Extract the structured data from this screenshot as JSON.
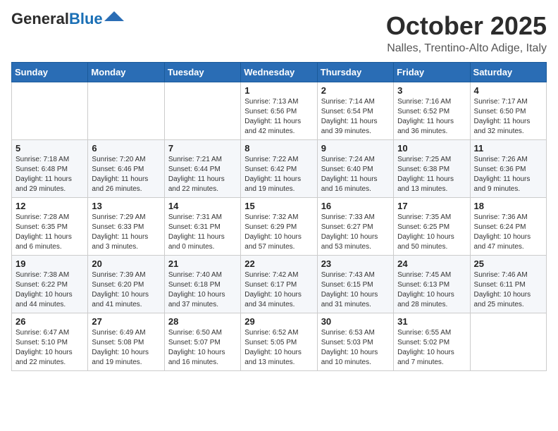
{
  "header": {
    "logo_general": "General",
    "logo_blue": "Blue",
    "month_title": "October 2025",
    "location": "Nalles, Trentino-Alto Adige, Italy"
  },
  "weekdays": [
    "Sunday",
    "Monday",
    "Tuesday",
    "Wednesday",
    "Thursday",
    "Friday",
    "Saturday"
  ],
  "weeks": [
    [
      {
        "day": "",
        "sunrise": "",
        "sunset": "",
        "daylight": ""
      },
      {
        "day": "",
        "sunrise": "",
        "sunset": "",
        "daylight": ""
      },
      {
        "day": "",
        "sunrise": "",
        "sunset": "",
        "daylight": ""
      },
      {
        "day": "1",
        "sunrise": "Sunrise: 7:13 AM",
        "sunset": "Sunset: 6:56 PM",
        "daylight": "Daylight: 11 hours and 42 minutes."
      },
      {
        "day": "2",
        "sunrise": "Sunrise: 7:14 AM",
        "sunset": "Sunset: 6:54 PM",
        "daylight": "Daylight: 11 hours and 39 minutes."
      },
      {
        "day": "3",
        "sunrise": "Sunrise: 7:16 AM",
        "sunset": "Sunset: 6:52 PM",
        "daylight": "Daylight: 11 hours and 36 minutes."
      },
      {
        "day": "4",
        "sunrise": "Sunrise: 7:17 AM",
        "sunset": "Sunset: 6:50 PM",
        "daylight": "Daylight: 11 hours and 32 minutes."
      }
    ],
    [
      {
        "day": "5",
        "sunrise": "Sunrise: 7:18 AM",
        "sunset": "Sunset: 6:48 PM",
        "daylight": "Daylight: 11 hours and 29 minutes."
      },
      {
        "day": "6",
        "sunrise": "Sunrise: 7:20 AM",
        "sunset": "Sunset: 6:46 PM",
        "daylight": "Daylight: 11 hours and 26 minutes."
      },
      {
        "day": "7",
        "sunrise": "Sunrise: 7:21 AM",
        "sunset": "Sunset: 6:44 PM",
        "daylight": "Daylight: 11 hours and 22 minutes."
      },
      {
        "day": "8",
        "sunrise": "Sunrise: 7:22 AM",
        "sunset": "Sunset: 6:42 PM",
        "daylight": "Daylight: 11 hours and 19 minutes."
      },
      {
        "day": "9",
        "sunrise": "Sunrise: 7:24 AM",
        "sunset": "Sunset: 6:40 PM",
        "daylight": "Daylight: 11 hours and 16 minutes."
      },
      {
        "day": "10",
        "sunrise": "Sunrise: 7:25 AM",
        "sunset": "Sunset: 6:38 PM",
        "daylight": "Daylight: 11 hours and 13 minutes."
      },
      {
        "day": "11",
        "sunrise": "Sunrise: 7:26 AM",
        "sunset": "Sunset: 6:36 PM",
        "daylight": "Daylight: 11 hours and 9 minutes."
      }
    ],
    [
      {
        "day": "12",
        "sunrise": "Sunrise: 7:28 AM",
        "sunset": "Sunset: 6:35 PM",
        "daylight": "Daylight: 11 hours and 6 minutes."
      },
      {
        "day": "13",
        "sunrise": "Sunrise: 7:29 AM",
        "sunset": "Sunset: 6:33 PM",
        "daylight": "Daylight: 11 hours and 3 minutes."
      },
      {
        "day": "14",
        "sunrise": "Sunrise: 7:31 AM",
        "sunset": "Sunset: 6:31 PM",
        "daylight": "Daylight: 11 hours and 0 minutes."
      },
      {
        "day": "15",
        "sunrise": "Sunrise: 7:32 AM",
        "sunset": "Sunset: 6:29 PM",
        "daylight": "Daylight: 10 hours and 57 minutes."
      },
      {
        "day": "16",
        "sunrise": "Sunrise: 7:33 AM",
        "sunset": "Sunset: 6:27 PM",
        "daylight": "Daylight: 10 hours and 53 minutes."
      },
      {
        "day": "17",
        "sunrise": "Sunrise: 7:35 AM",
        "sunset": "Sunset: 6:25 PM",
        "daylight": "Daylight: 10 hours and 50 minutes."
      },
      {
        "day": "18",
        "sunrise": "Sunrise: 7:36 AM",
        "sunset": "Sunset: 6:24 PM",
        "daylight": "Daylight: 10 hours and 47 minutes."
      }
    ],
    [
      {
        "day": "19",
        "sunrise": "Sunrise: 7:38 AM",
        "sunset": "Sunset: 6:22 PM",
        "daylight": "Daylight: 10 hours and 44 minutes."
      },
      {
        "day": "20",
        "sunrise": "Sunrise: 7:39 AM",
        "sunset": "Sunset: 6:20 PM",
        "daylight": "Daylight: 10 hours and 41 minutes."
      },
      {
        "day": "21",
        "sunrise": "Sunrise: 7:40 AM",
        "sunset": "Sunset: 6:18 PM",
        "daylight": "Daylight: 10 hours and 37 minutes."
      },
      {
        "day": "22",
        "sunrise": "Sunrise: 7:42 AM",
        "sunset": "Sunset: 6:17 PM",
        "daylight": "Daylight: 10 hours and 34 minutes."
      },
      {
        "day": "23",
        "sunrise": "Sunrise: 7:43 AM",
        "sunset": "Sunset: 6:15 PM",
        "daylight": "Daylight: 10 hours and 31 minutes."
      },
      {
        "day": "24",
        "sunrise": "Sunrise: 7:45 AM",
        "sunset": "Sunset: 6:13 PM",
        "daylight": "Daylight: 10 hours and 28 minutes."
      },
      {
        "day": "25",
        "sunrise": "Sunrise: 7:46 AM",
        "sunset": "Sunset: 6:11 PM",
        "daylight": "Daylight: 10 hours and 25 minutes."
      }
    ],
    [
      {
        "day": "26",
        "sunrise": "Sunrise: 6:47 AM",
        "sunset": "Sunset: 5:10 PM",
        "daylight": "Daylight: 10 hours and 22 minutes."
      },
      {
        "day": "27",
        "sunrise": "Sunrise: 6:49 AM",
        "sunset": "Sunset: 5:08 PM",
        "daylight": "Daylight: 10 hours and 19 minutes."
      },
      {
        "day": "28",
        "sunrise": "Sunrise: 6:50 AM",
        "sunset": "Sunset: 5:07 PM",
        "daylight": "Daylight: 10 hours and 16 minutes."
      },
      {
        "day": "29",
        "sunrise": "Sunrise: 6:52 AM",
        "sunset": "Sunset: 5:05 PM",
        "daylight": "Daylight: 10 hours and 13 minutes."
      },
      {
        "day": "30",
        "sunrise": "Sunrise: 6:53 AM",
        "sunset": "Sunset: 5:03 PM",
        "daylight": "Daylight: 10 hours and 10 minutes."
      },
      {
        "day": "31",
        "sunrise": "Sunrise: 6:55 AM",
        "sunset": "Sunset: 5:02 PM",
        "daylight": "Daylight: 10 hours and 7 minutes."
      },
      {
        "day": "",
        "sunrise": "",
        "sunset": "",
        "daylight": ""
      }
    ]
  ]
}
